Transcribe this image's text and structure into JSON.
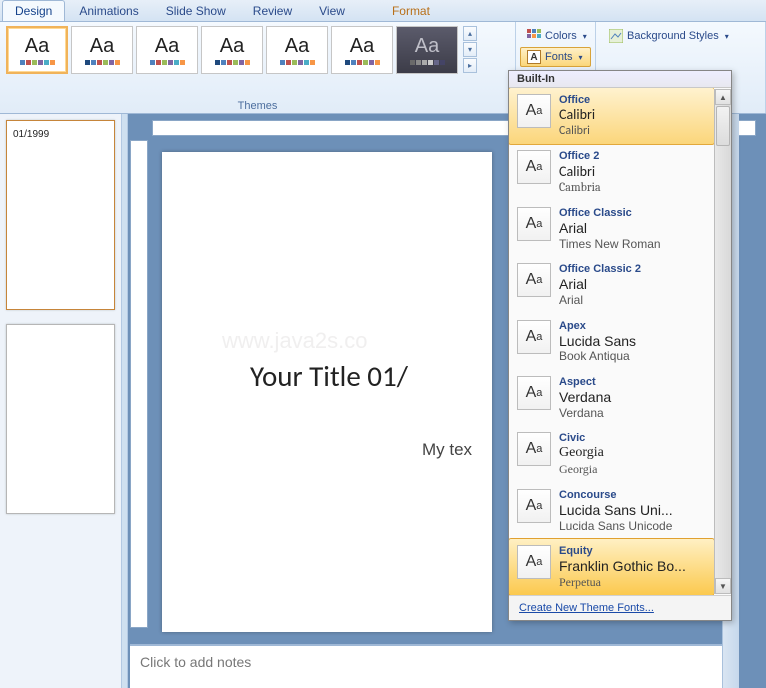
{
  "tabs": [
    "Design",
    "Animations",
    "Slide Show",
    "Review",
    "View",
    "Format"
  ],
  "active_tab": "Design",
  "ribbon": {
    "themes_label": "Themes",
    "colors_label": "Colors",
    "fonts_label": "Fonts",
    "bg_label": "Background Styles"
  },
  "slide": {
    "thumb_text": "01/1999",
    "watermark": "www.java2s.co",
    "title": "Your Title 01/",
    "body": "My tex"
  },
  "notes_placeholder": "Click to add notes",
  "fonts_popup": {
    "header": "Built-In",
    "items": [
      {
        "name": "Office",
        "major": "Calibri",
        "minor": "Calibri",
        "hi": "hi"
      },
      {
        "name": "Office 2",
        "major": "Calibri",
        "minor": "Cambria"
      },
      {
        "name": "Office Classic",
        "major": "Arial",
        "minor": "Times New Roman"
      },
      {
        "name": "Office Classic 2",
        "major": "Arial",
        "minor": "Arial"
      },
      {
        "name": "Apex",
        "major": "Lucida Sans",
        "minor": "Book Antiqua"
      },
      {
        "name": "Aspect",
        "major": "Verdana",
        "minor": "Verdana"
      },
      {
        "name": "Civic",
        "major": "Georgia",
        "minor": "Georgia"
      },
      {
        "name": "Concourse",
        "major": "Lucida Sans Uni...",
        "minor": "Lucida Sans Unicode"
      },
      {
        "name": "Equity",
        "major": "Franklin Gothic Bo...",
        "minor": "Perpetua",
        "hi": "hi2"
      }
    ],
    "footer": "Create New Theme Fonts..."
  },
  "theme_colors": [
    [
      "#4f81bd",
      "#c0504d",
      "#9bbb59",
      "#8064a2",
      "#4bacc6",
      "#f79646"
    ],
    [
      "#1f497d",
      "#4f81bd",
      "#c0504d",
      "#9bbb59",
      "#8064a2",
      "#f79646"
    ],
    [
      "#6a6a6a",
      "#8a8a8a",
      "#aaaaaa",
      "#cccccc",
      "#666688",
      "#444466"
    ]
  ]
}
